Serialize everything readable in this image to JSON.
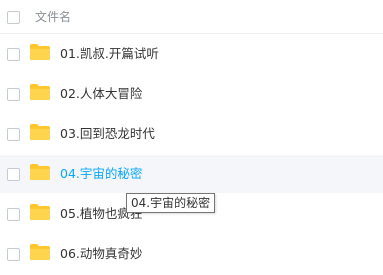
{
  "header": {
    "column_label": "文件名"
  },
  "files": [
    {
      "name": "01.凯叔.开篇试听"
    },
    {
      "name": "02.人体大冒险"
    },
    {
      "name": "03.回到恐龙时代"
    },
    {
      "name": "04.宇宙的秘密"
    },
    {
      "name": "05.植物也疯狂"
    },
    {
      "name": "06.动物真奇妙"
    }
  ],
  "tooltip": {
    "text": "04.宇宙的秘密"
  },
  "colors": {
    "accent": "#06a7ff",
    "folder": "#ffc72c",
    "hover_row": "#f5f6fa"
  },
  "icons": {
    "folder": "folder-icon",
    "checkbox": "checkbox"
  }
}
